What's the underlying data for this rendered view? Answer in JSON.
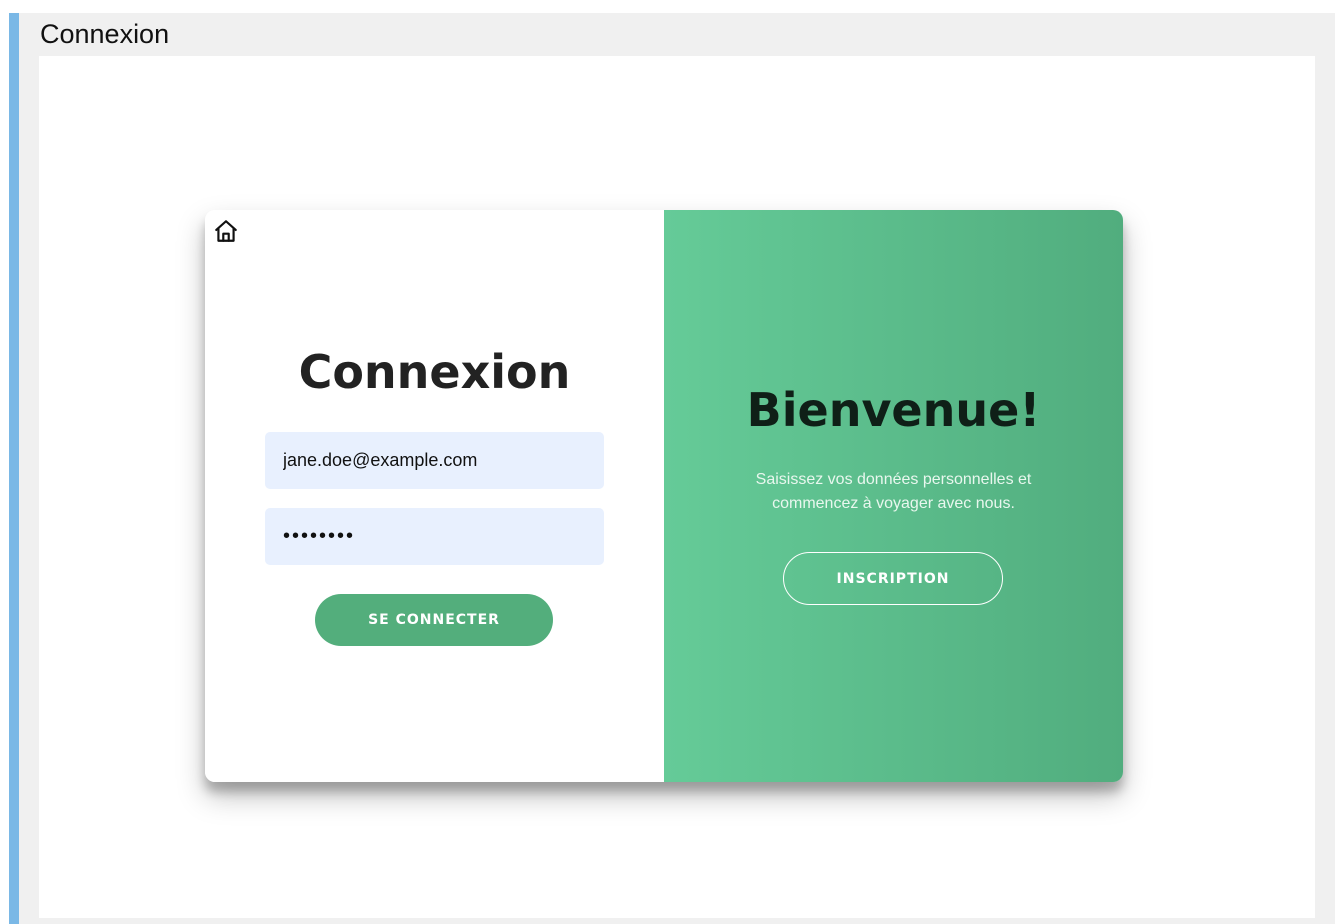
{
  "window": {
    "title": "Connexion"
  },
  "login": {
    "home_icon": "home-icon",
    "title": "Connexion",
    "email_value": "jane.doe@example.com",
    "password_value": "••••••••",
    "submit_label": "SE CONNECTER"
  },
  "welcome": {
    "title": "Bienvenue!",
    "subtitle": "Saisissez vos données personnelles et commencez à voyager avec nous.",
    "signup_label": "INSCRIPTION"
  },
  "colors": {
    "accent_green": "#53ae7c",
    "gradient_start": "#65cb98",
    "gradient_end": "#51ad7e",
    "input_bg": "#e8f0fe",
    "side_accent": "#7ab8e6"
  }
}
